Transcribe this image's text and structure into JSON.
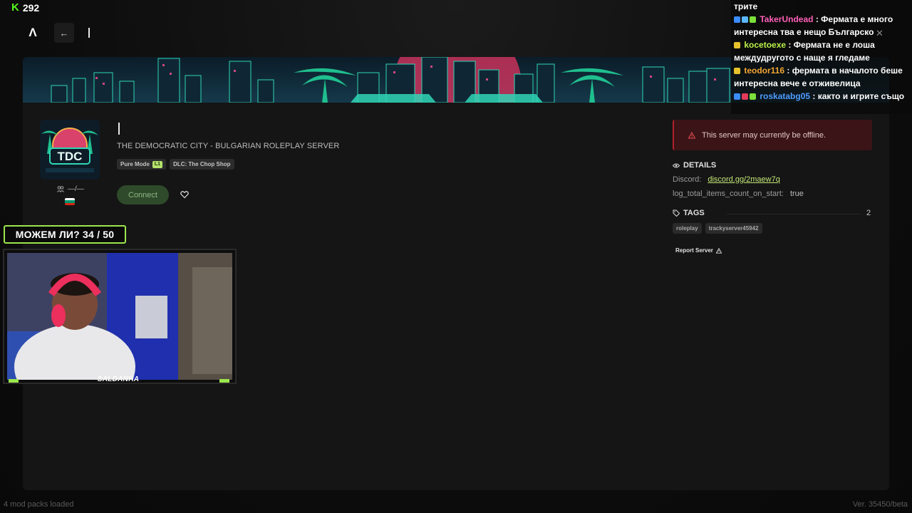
{
  "stream": {
    "viewer_count": "292",
    "goal_label": "МОЖЕМ ЛИ? 34 / 50",
    "streamer_name": "SALDANHA"
  },
  "nav": {
    "logo_letter": "Λ",
    "back_symbol": "←"
  },
  "server": {
    "logo_text": "TDC",
    "description": "THE DEMOCRATIC CITY - BULGARIAN ROLEPLAY SERVER",
    "badges": [
      {
        "label": "Pure Mode",
        "level": "L1"
      },
      {
        "label": "DLC: The Chop Shop",
        "level": ""
      }
    ],
    "players": "—/—",
    "connect_label": "Connect",
    "offline_message": "This server may currently be offline.",
    "details_title": "DETAILS",
    "details": [
      {
        "key": "Discord:",
        "value": "discord.gg/2maew7q",
        "is_link": true
      },
      {
        "key": "log_total_items_count_on_start:",
        "value": "true",
        "is_link": false
      }
    ],
    "tags_title": "TAGS",
    "tags_count": "2",
    "tags": [
      "roleplay",
      "trackyserver45942"
    ],
    "report_label": "Report Server"
  },
  "footer": {
    "mods_loaded": "4 mod packs loaded",
    "version": "Ver. 35450/beta"
  },
  "chat": {
    "messages": [
      {
        "user": "",
        "color": "#ffffff",
        "text": "трите",
        "icons": []
      },
      {
        "user": "TakerUndead",
        "color": "#ff5fb8",
        "text": " : Фермата е много интересна тва е нещо Българско",
        "icons": [
          "#3a8cff",
          "#5ab7ff",
          "#7be03a"
        ]
      },
      {
        "user": "kocetoexe",
        "color": "#b8f04a",
        "text": " : Фермата не е лоша междудругото с наще я гледаме",
        "icons": [
          "#e7c12b"
        ]
      },
      {
        "user": "teodor116",
        "color": "#f2a533",
        "text": " : фермата в началото беше интересна вече е отживелица",
        "icons": [
          "#e7c12b"
        ]
      },
      {
        "user": "roskatabg05",
        "color": "#4d9cff",
        "text": " : както и игрите също",
        "icons": [
          "#3a8cff",
          "#e23a5a",
          "#7be03a"
        ]
      }
    ],
    "close_symbol": "✕"
  },
  "colors": {
    "accent_green": "#9ce64c",
    "kick_green": "#53fc18",
    "offline_red": "#b1212b",
    "link_green": "#c4e878"
  }
}
